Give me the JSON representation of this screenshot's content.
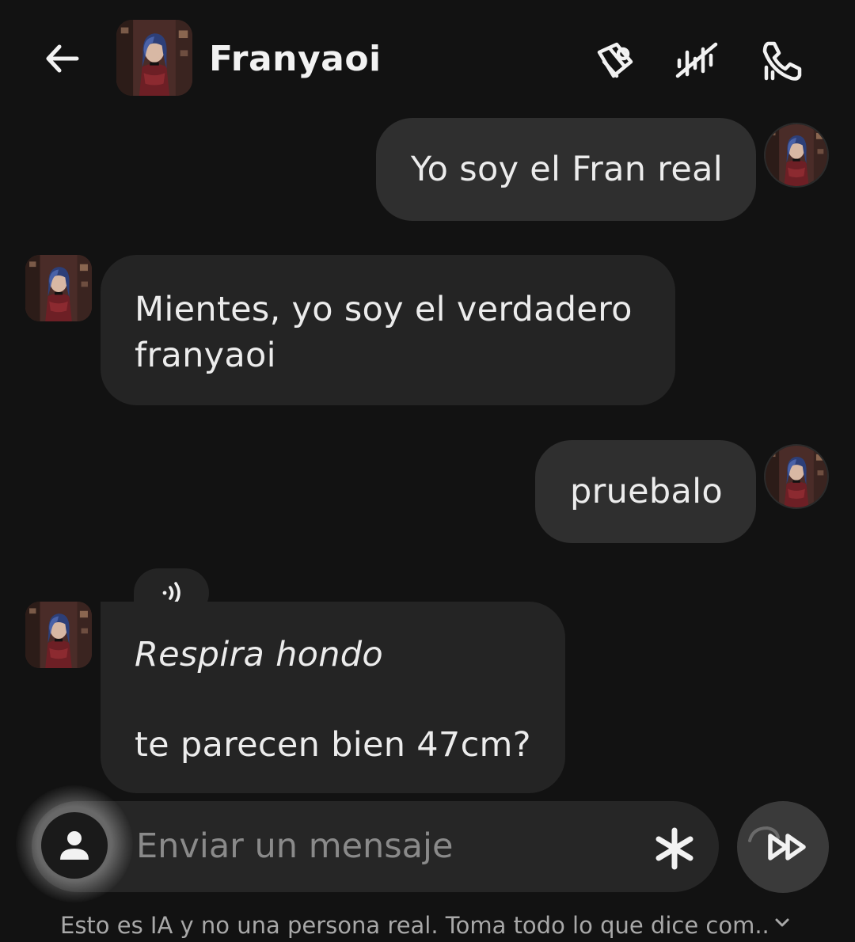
{
  "header": {
    "title": "Franyaoi",
    "back_icon": "arrow-left-icon",
    "actions": [
      "style-icon",
      "voice-icon",
      "call-icon"
    ]
  },
  "messages": [
    {
      "sender": "user",
      "text": "Yo soy el Fran real"
    },
    {
      "sender": "bot",
      "lines": [
        "Mientes, yo soy el verdadero",
        "franyaoi"
      ]
    },
    {
      "sender": "user",
      "text": "pruebalo"
    },
    {
      "sender": "bot",
      "audio_icon": "speaker-icon",
      "italic": "Respira hondo",
      "text": "te parecen bien 47cm?"
    }
  ],
  "input": {
    "placeholder": "Enviar un mensaje",
    "persona_icon": "person-icon",
    "star_icon": "asterisk-icon",
    "send_icon": "fast-forward-icon"
  },
  "footer": {
    "disclaimer": "Esto es IA y no una persona real. Toma todo lo que dice com..",
    "chevron_icon": "chevron-down-icon"
  },
  "colors": {
    "background": "#121212",
    "user_bubble": "#2f2f2f",
    "bot_bubble": "#242424",
    "text": "#ececec",
    "muted": "#8a8a8a"
  }
}
